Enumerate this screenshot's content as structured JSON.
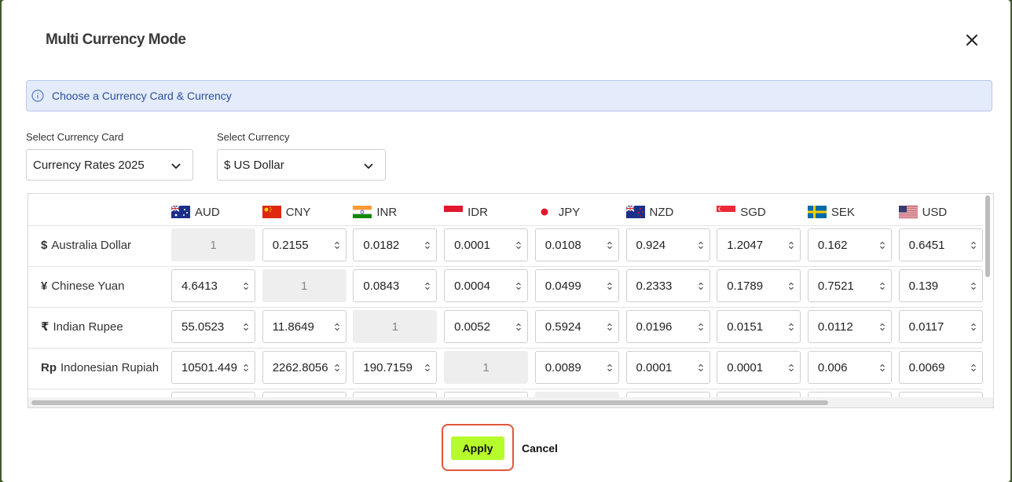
{
  "dialog": {
    "title": "Multi Currency Mode",
    "info": "Choose a Currency Card & Currency",
    "apply_label": "Apply",
    "cancel_label": "Cancel",
    "accent_color": "#b6fb2b",
    "highlight_color": "#e0563a"
  },
  "filters": {
    "card_label": "Select Currency Card",
    "card_value": "Currency Rates 2025",
    "currency_label": "Select Currency",
    "currency_value": "$ US Dollar"
  },
  "columns": [
    {
      "code": "AUD",
      "flag": "australia-flag-icon"
    },
    {
      "code": "CNY",
      "flag": "china-flag-icon"
    },
    {
      "code": "INR",
      "flag": "india-flag-icon"
    },
    {
      "code": "IDR",
      "flag": "indonesia-flag-icon"
    },
    {
      "code": "JPY",
      "flag": "japan-flag-icon"
    },
    {
      "code": "NZD",
      "flag": "new-zealand-flag-icon"
    },
    {
      "code": "SGD",
      "flag": "singapore-flag-icon"
    },
    {
      "code": "SEK",
      "flag": "sweden-flag-icon"
    },
    {
      "code": "USD",
      "flag": "usa-flag-icon"
    }
  ],
  "rows": [
    {
      "symbol": "$",
      "name": "Australia Dollar",
      "values": [
        "1",
        "0.2155",
        "0.0182",
        "0.0001",
        "0.0108",
        "0.924",
        "1.2047",
        "0.162",
        "0.6451"
      ]
    },
    {
      "symbol": "¥",
      "name": "Chinese Yuan",
      "values": [
        "4.6413",
        "1",
        "0.0843",
        "0.0004",
        "0.0499",
        "0.2333",
        "0.1789",
        "0.7521",
        "0.139"
      ]
    },
    {
      "symbol": "₹",
      "name": "Indian Rupee",
      "values": [
        "55.0523",
        "11.8649",
        "1",
        "0.0052",
        "0.5924",
        "0.0196",
        "0.0151",
        "0.0112",
        "0.0117"
      ]
    },
    {
      "symbol": "Rp",
      "name": "Indonesian Rupiah",
      "values": [
        "10501.449",
        "2262.8056",
        "190.7159",
        "1",
        "0.0089",
        "0.0001",
        "0.0001",
        "0.006",
        "0.0069"
      ]
    }
  ]
}
